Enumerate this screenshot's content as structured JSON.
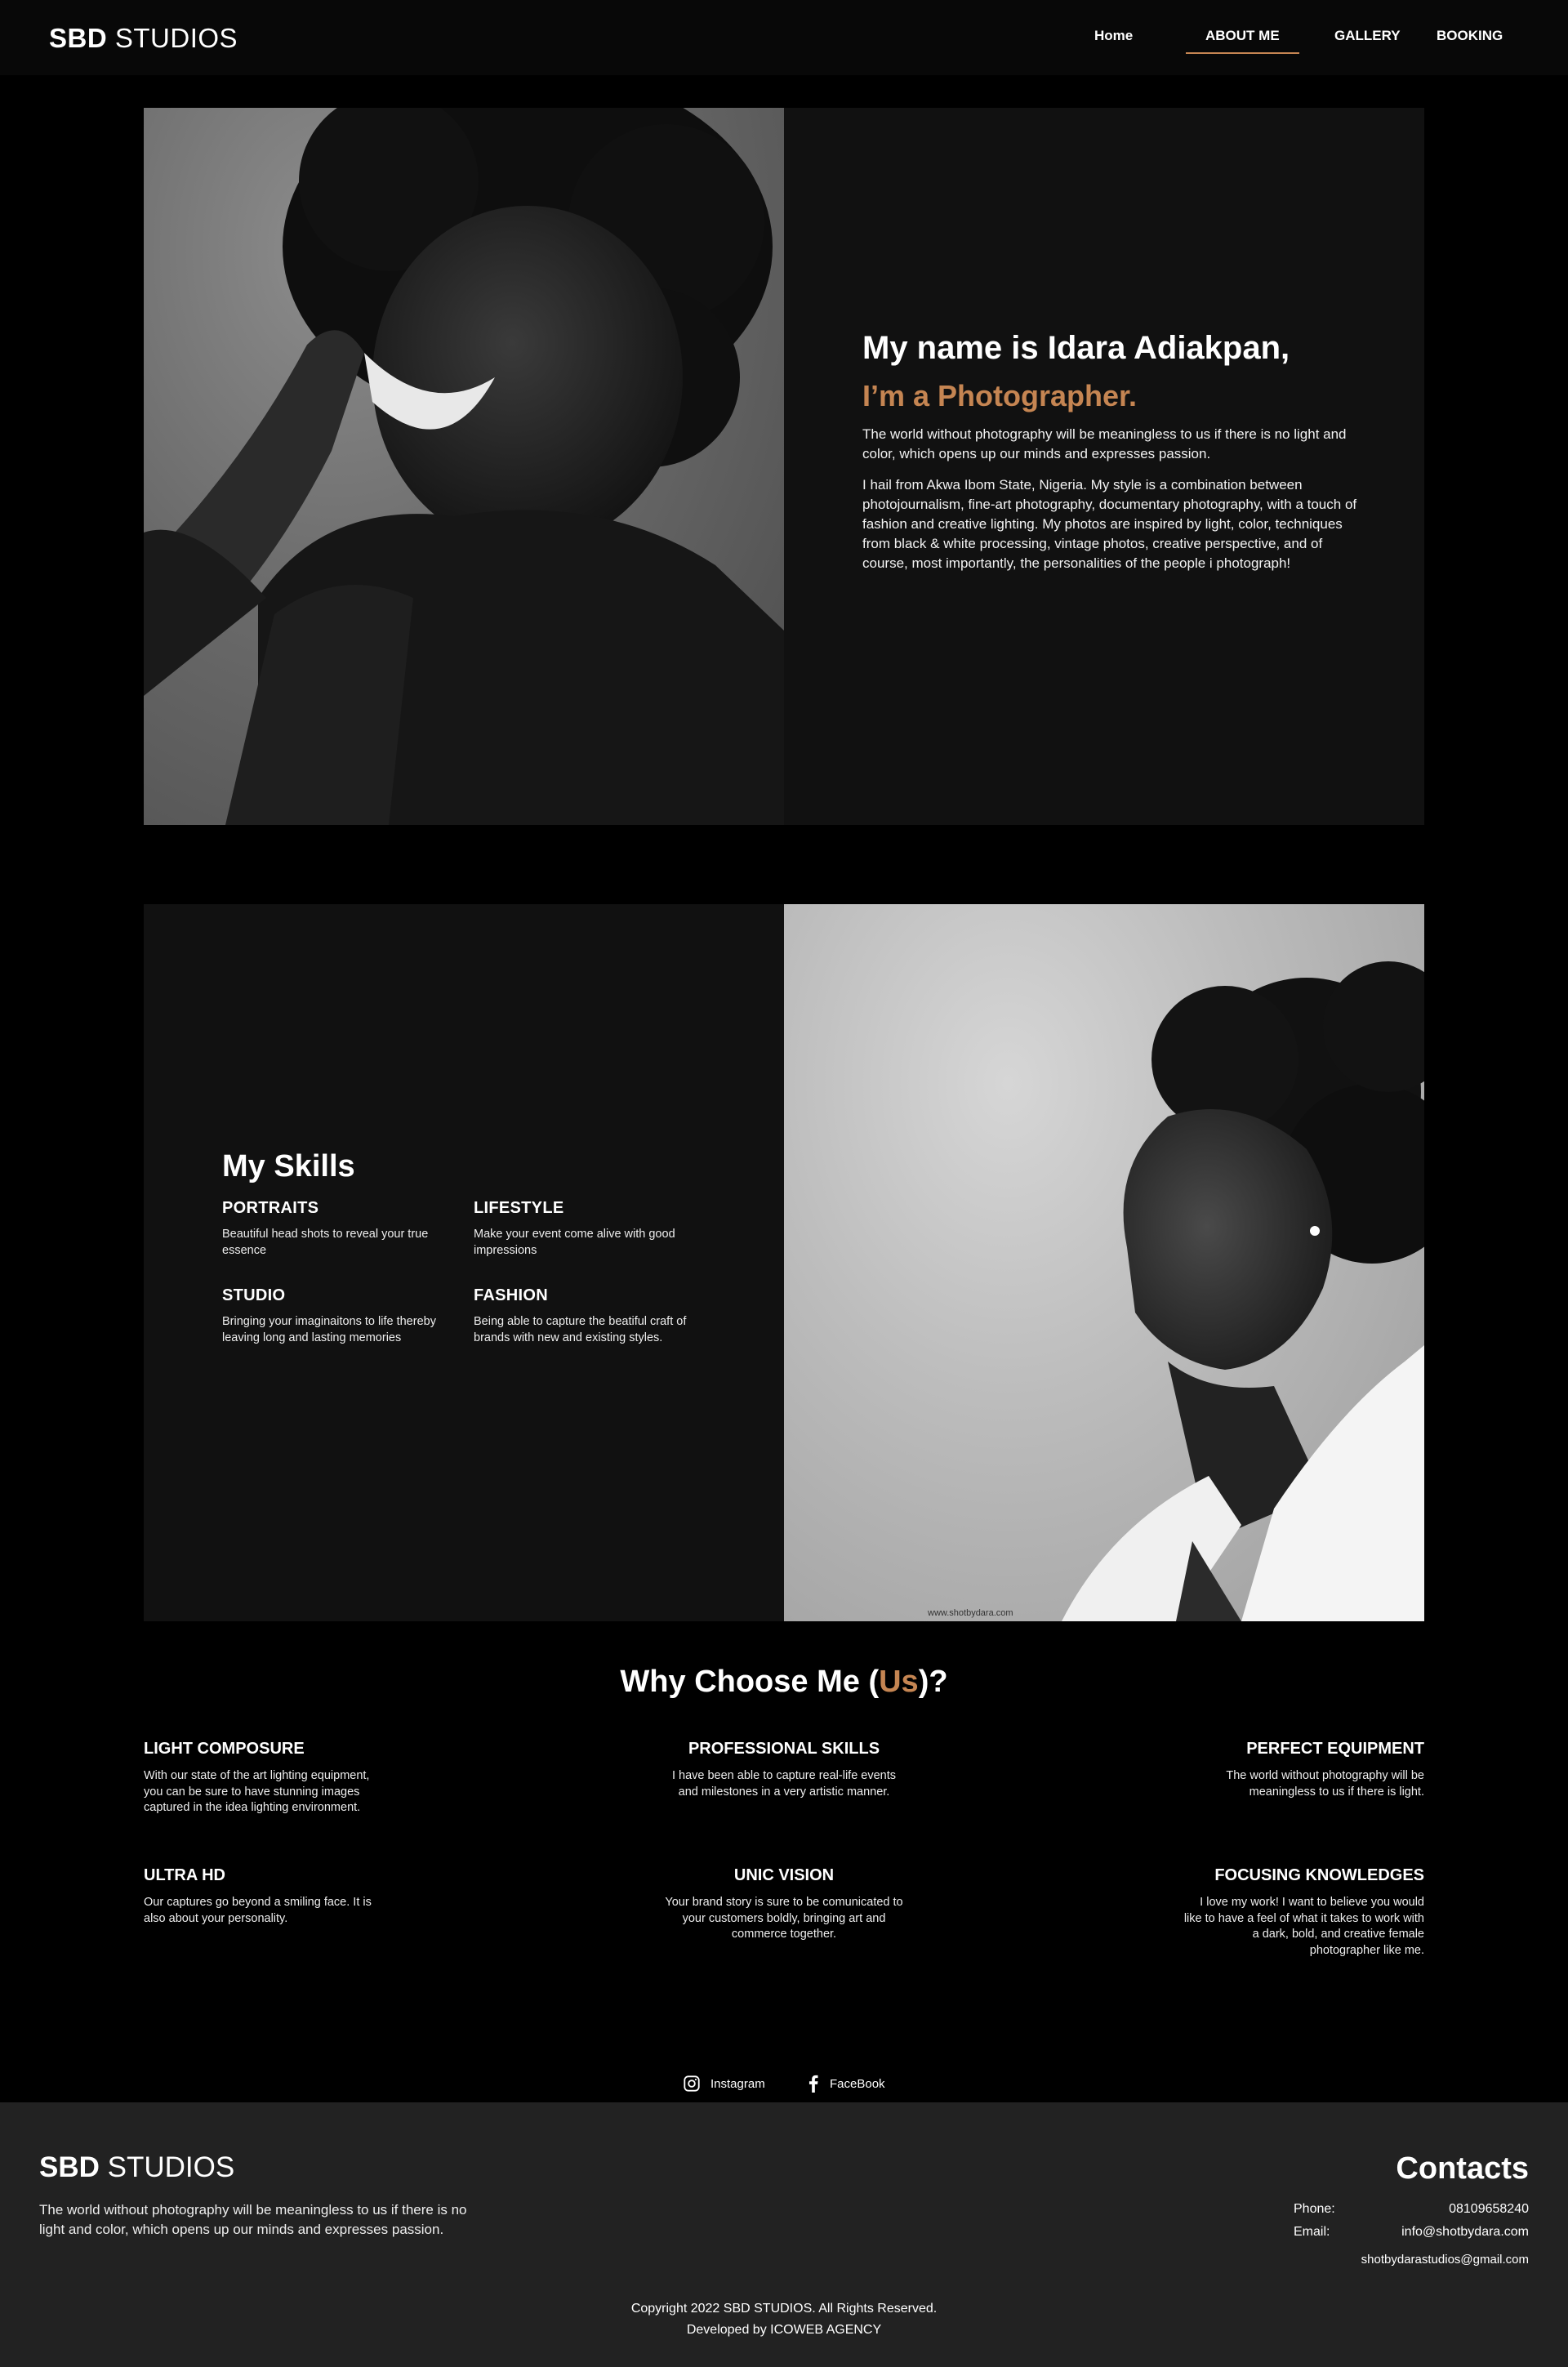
{
  "nav": {
    "logo_bold": "SBD",
    "logo_light": "STUDIOS",
    "links": [
      "Home",
      "ABOUT ME",
      "GALLERY",
      "BOOKING"
    ]
  },
  "about": {
    "name_line": "My name is Idara Adiakpan,",
    "role_line": "I’m a Photographer.",
    "intro": "The world without photography will be meaningless to us if there is no light and color, which opens up our minds and expresses passion.",
    "bio": "I hail from Akwa Ibom State, Nigeria. My style is a combination between photojournalism, fine-art photography, documentary photography, with a touch of fashion and creative lighting. My photos are inspired by light, color, techniques from black & white processing, vintage photos, creative perspective, and of course, most importantly, the personalities of the people i photograph!"
  },
  "skills": {
    "title": "My Skills",
    "items": [
      {
        "title": "PORTRAITS",
        "desc": "Beautiful head shots to reveal your true essence"
      },
      {
        "title": "LIFESTYLE",
        "desc": "Make your event come alive with good impressions"
      },
      {
        "title": "STUDIO",
        "desc": "Bringing your imaginaitons to life thereby leaving long and lasting memories"
      },
      {
        "title": "FASHION",
        "desc": "Being able to capture the beatiful craft of brands with new and existing styles."
      }
    ],
    "watermark": "www.shotbydara.com"
  },
  "why": {
    "title_pre": "Why Choose Me (",
    "title_accent": "Us",
    "title_post": ")?",
    "features": [
      {
        "title": "LIGHT COMPOSURE",
        "desc": "With our state of the art lighting equipment, you can be sure to have stunning images captured in the idea lighting environment."
      },
      {
        "title": "PROFESSIONAL SKILLS",
        "desc": "I have been able to capture real-life events and milestones in a very artistic manner."
      },
      {
        "title": "PERFECT EQUIPMENT",
        "desc": "The world without photography will be meaningless to us if there is light."
      },
      {
        "title": "ULTRA HD",
        "desc": "Our captures go beyond a smiling face. It is also about your personality."
      },
      {
        "title": "UNIC VISION",
        "desc": "Your brand story is sure to be comunicated to your customers boldly, bringing art and commerce together."
      },
      {
        "title": "FOCUSING KNOWLEDGES",
        "desc": "I love my work! I want to believe you would like to have a feel of what it takes to work with a dark, bold, and creative female photographer like me."
      }
    ]
  },
  "social": {
    "instagram": "Instagram",
    "facebook": "FaceBook"
  },
  "footer": {
    "logo_bold": "SBD",
    "logo_light": "STUDIOS",
    "desc": "The world without photography will be meaningless to us if there is no light and color, which opens up our minds and expresses passion.",
    "contacts_title": "Contacts",
    "phone_label": "Phone:",
    "phone": "08109658240",
    "email_label": "Email:",
    "email1": "info@shotbydara.com",
    "email2": "shotbydarastudios@gmail.com",
    "copyright": "Copyright 2022 SBD STUDIOS. All Rights Reserved.",
    "developed": "Developed by ICOWEB AGENCY"
  },
  "colors": {
    "accent": "#c58552",
    "background": "#000000",
    "panel": "#111111",
    "footer": "#222222"
  }
}
